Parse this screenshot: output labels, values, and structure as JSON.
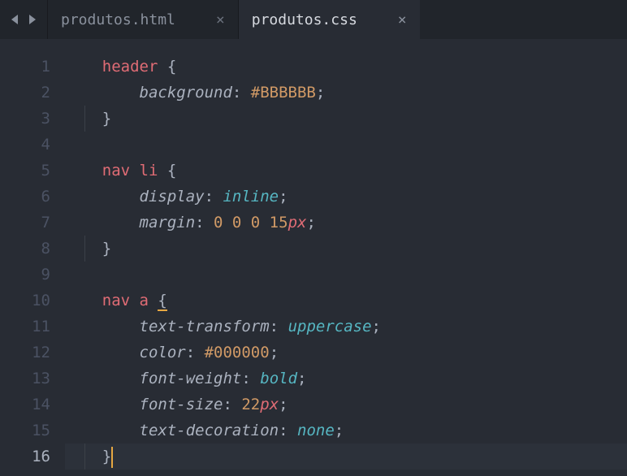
{
  "tabs": [
    {
      "name": "produtos.html",
      "active": false
    },
    {
      "name": "produtos.css",
      "active": true
    }
  ],
  "lineCount": 16,
  "cursorLine": 16,
  "code": {
    "lines": [
      {
        "n": 1,
        "indent": 0,
        "tokens": [
          {
            "t": "header ",
            "c": "tok-sel"
          },
          {
            "t": "{",
            "c": "tok-punct"
          }
        ]
      },
      {
        "n": 2,
        "indent": 1,
        "tokens": [
          {
            "t": "background",
            "c": "tok-prop"
          },
          {
            "t": ": ",
            "c": "tok-punct"
          },
          {
            "t": "#BBBBBB",
            "c": "tok-color"
          },
          {
            "t": ";",
            "c": "tok-punct"
          }
        ]
      },
      {
        "n": 3,
        "indent": 0,
        "guide": true,
        "tokens": [
          {
            "t": "}",
            "c": "tok-punct"
          }
        ]
      },
      {
        "n": 4,
        "indent": 0,
        "tokens": []
      },
      {
        "n": 5,
        "indent": 0,
        "tokens": [
          {
            "t": "nav li ",
            "c": "tok-sel"
          },
          {
            "t": "{",
            "c": "tok-punct"
          }
        ]
      },
      {
        "n": 6,
        "indent": 1,
        "tokens": [
          {
            "t": "display",
            "c": "tok-prop"
          },
          {
            "t": ": ",
            "c": "tok-punct"
          },
          {
            "t": "inline",
            "c": "tok-kw"
          },
          {
            "t": ";",
            "c": "tok-punct"
          }
        ]
      },
      {
        "n": 7,
        "indent": 1,
        "tokens": [
          {
            "t": "margin",
            "c": "tok-prop"
          },
          {
            "t": ": ",
            "c": "tok-punct"
          },
          {
            "t": "0 0 0 15",
            "c": "tok-num"
          },
          {
            "t": "px",
            "c": "tok-unit"
          },
          {
            "t": ";",
            "c": "tok-punct"
          }
        ]
      },
      {
        "n": 8,
        "indent": 0,
        "guide": true,
        "tokens": [
          {
            "t": "}",
            "c": "tok-punct"
          }
        ]
      },
      {
        "n": 9,
        "indent": 0,
        "tokens": []
      },
      {
        "n": 10,
        "indent": 0,
        "tokens": [
          {
            "t": "nav a ",
            "c": "tok-sel"
          },
          {
            "t": "{",
            "c": "tok-punct",
            "underline": true
          }
        ]
      },
      {
        "n": 11,
        "indent": 1,
        "tokens": [
          {
            "t": "text-transform",
            "c": "tok-prop"
          },
          {
            "t": ": ",
            "c": "tok-punct"
          },
          {
            "t": "uppercase",
            "c": "tok-kw"
          },
          {
            "t": ";",
            "c": "tok-punct"
          }
        ]
      },
      {
        "n": 12,
        "indent": 1,
        "tokens": [
          {
            "t": "color",
            "c": "tok-prop"
          },
          {
            "t": ": ",
            "c": "tok-punct"
          },
          {
            "t": "#000000",
            "c": "tok-color"
          },
          {
            "t": ";",
            "c": "tok-punct"
          }
        ]
      },
      {
        "n": 13,
        "indent": 1,
        "tokens": [
          {
            "t": "font-weight",
            "c": "tok-prop"
          },
          {
            "t": ": ",
            "c": "tok-punct"
          },
          {
            "t": "bold",
            "c": "tok-kw"
          },
          {
            "t": ";",
            "c": "tok-punct"
          }
        ]
      },
      {
        "n": 14,
        "indent": 1,
        "tokens": [
          {
            "t": "font-size",
            "c": "tok-prop"
          },
          {
            "t": ": ",
            "c": "tok-punct"
          },
          {
            "t": "22",
            "c": "tok-num"
          },
          {
            "t": "px",
            "c": "tok-unit"
          },
          {
            "t": ";",
            "c": "tok-punct"
          }
        ]
      },
      {
        "n": 15,
        "indent": 1,
        "tokens": [
          {
            "t": "text-decoration",
            "c": "tok-prop"
          },
          {
            "t": ": ",
            "c": "tok-punct"
          },
          {
            "t": "none",
            "c": "tok-kw"
          },
          {
            "t": ";",
            "c": "tok-punct"
          }
        ]
      },
      {
        "n": 16,
        "indent": 0,
        "guide": true,
        "cursorAfter": true,
        "tokens": [
          {
            "t": "}",
            "c": "tok-punct"
          }
        ]
      }
    ]
  }
}
